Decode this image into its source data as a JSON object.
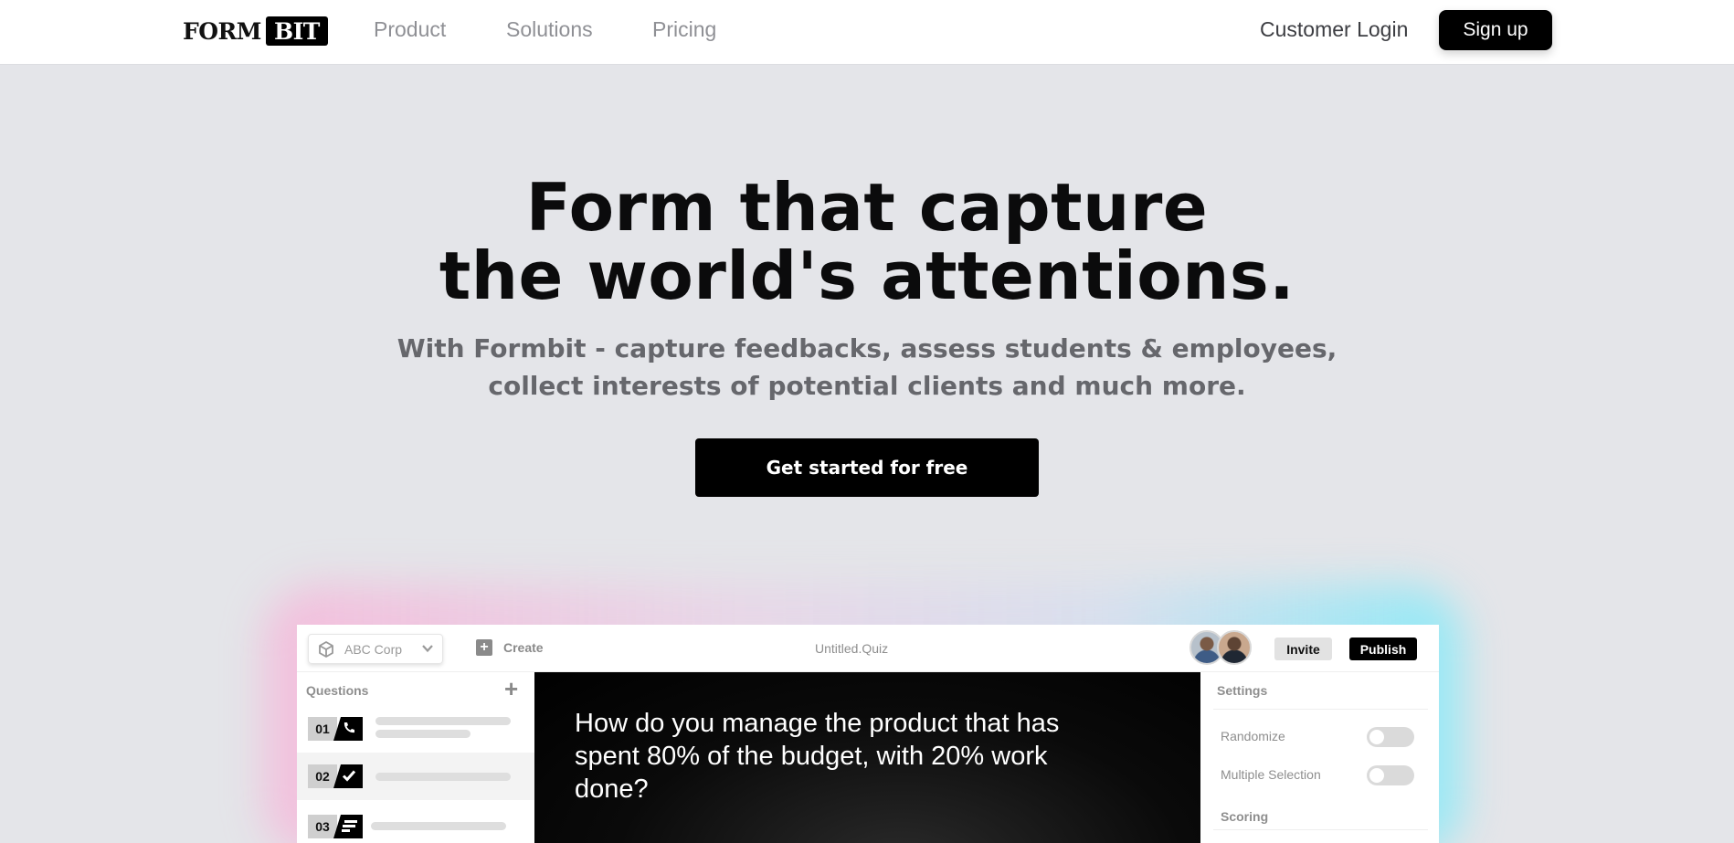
{
  "nav": {
    "logo_left": "FORM",
    "logo_right": "BIT",
    "links": [
      "Product",
      "Solutions",
      "Pricing"
    ],
    "login": "Customer Login",
    "signup": "Sign up"
  },
  "hero": {
    "title_line1": "Form that capture",
    "title_line2": "the world's attentions.",
    "subtitle_line1": "With Formbit - capture feedbacks, assess students & employees,",
    "subtitle_line2": "collect interests of potential clients and much more.",
    "cta": "Get started for free"
  },
  "app": {
    "org_name": "ABC Corp",
    "create_label": "Create",
    "doc_title": "Untitled.Quiz",
    "invite_label": "Invite",
    "publish_label": "Publish",
    "questions_header": "Questions",
    "questions": [
      {
        "num": "01",
        "icon": "phone-icon"
      },
      {
        "num": "02",
        "icon": "check-icon"
      },
      {
        "num": "03",
        "icon": "text-lines-icon"
      }
    ],
    "question_text": "How do you manage the product that has spent 80% of the budget, with 20% work done?",
    "settings": {
      "header": "Settings",
      "randomize": "Randomize",
      "multiple_selection": "Multiple Selection",
      "scoring": "Scoring"
    }
  },
  "colors": {
    "accent": "#000000",
    "page_bg": "#e4e5e9",
    "muted_text": "#66676c"
  }
}
